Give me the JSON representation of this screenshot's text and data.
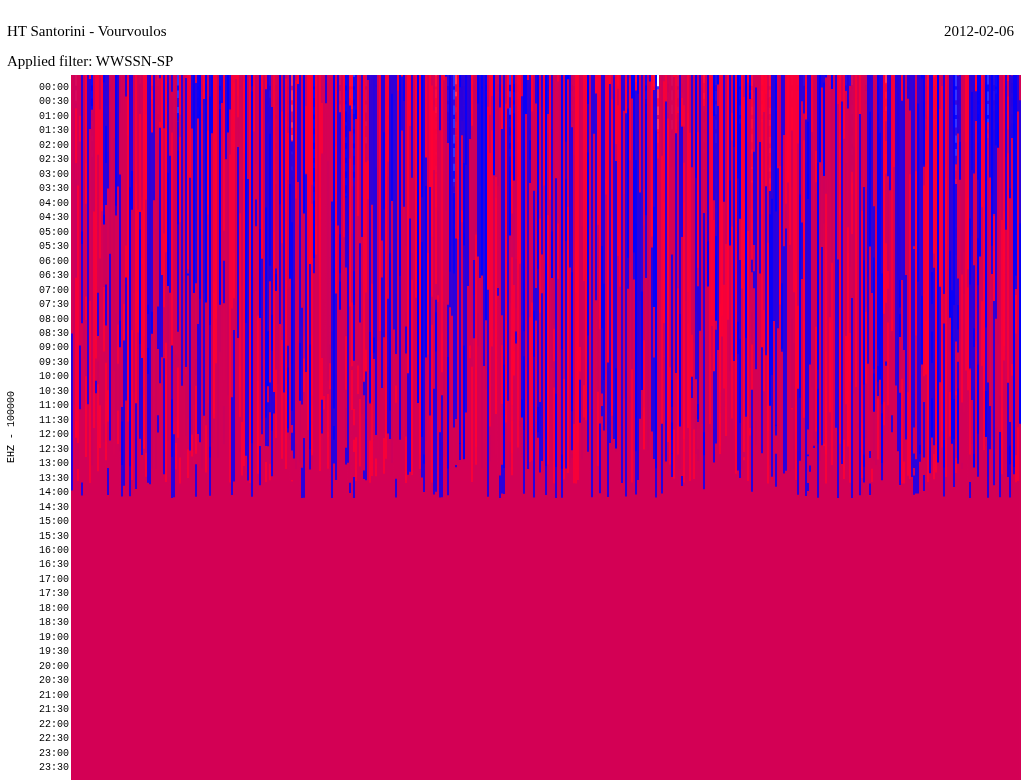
{
  "header": {
    "title": "HT Santorini - Vourvoulos",
    "date": "2012-02-06",
    "filter": "Applied filter: WWSSN-SP"
  },
  "axis": {
    "channel_label": "EHZ - 100000",
    "times": [
      "00:00",
      "00:30",
      "01:00",
      "01:30",
      "02:00",
      "02:30",
      "03:00",
      "03:30",
      "04:00",
      "04:30",
      "05:00",
      "05:30",
      "06:00",
      "06:30",
      "07:00",
      "07:30",
      "08:00",
      "08:30",
      "09:00",
      "09:30",
      "10:00",
      "10:30",
      "11:00",
      "11:30",
      "12:00",
      "12:30",
      "13:00",
      "13:30",
      "14:00",
      "14:30",
      "15:00",
      "15:30",
      "16:00",
      "16:30",
      "17:00",
      "17:30",
      "18:00",
      "18:30",
      "19:00",
      "19:30",
      "20:00",
      "20:30",
      "21:00",
      "21:30",
      "22:00",
      "22:30",
      "23:00",
      "23:30"
    ]
  }
}
